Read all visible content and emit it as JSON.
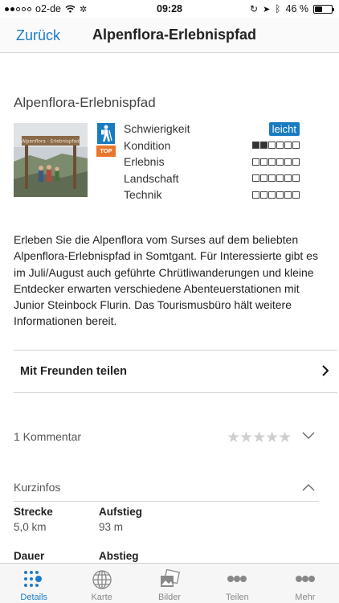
{
  "status_bar": {
    "carrier": "o2-de",
    "time": "09:28",
    "battery": "46 %",
    "battery_level": 0.46
  },
  "nav": {
    "back_label": "Zurück",
    "title": "Alpenflora-Erlebnispfad"
  },
  "tour": {
    "title": "Alpenflora-Erlebnispfad",
    "thumbnail_sign": "Alpenflora - Erlebnispfad",
    "top_badge": "TOP",
    "ratings": [
      {
        "label": "Schwierigkeit",
        "value": "leicht"
      },
      {
        "label": "Kondition",
        "level": 2,
        "max": 6
      },
      {
        "label": "Erlebnis",
        "level": 0,
        "max": 6
      },
      {
        "label": "Landschaft",
        "level": 0,
        "max": 6
      },
      {
        "label": "Technik",
        "level": 0,
        "max": 6
      }
    ],
    "description": "Erleben Sie die Alpenflora vom Surses auf dem beliebten Alpenflora-Erlebnispfad in Somtgant. Für Interessierte gibt es im Juli/August auch geführte Chrütliwanderungen und kleine Entdecker erwarten verschiedene Abenteuerstationen mit Junior Steinbock Flurin. Das Tourismusbüro hält weitere Informationen bereit."
  },
  "share": {
    "label": "Mit Freunden teilen"
  },
  "comments": {
    "label": "1 Kommentar",
    "stars": "★★★★★",
    "rating": 0
  },
  "kurzinfos": {
    "label": "Kurzinfos",
    "strecke": {
      "label": "Strecke",
      "value": "5,0 km"
    },
    "aufstieg": {
      "label": "Aufstieg",
      "value": "93 m"
    },
    "dauer": {
      "label": "Dauer"
    },
    "abstieg": {
      "label": "Abstieg"
    }
  },
  "tabs": [
    {
      "label": "Details",
      "icon": "details-icon",
      "active": true
    },
    {
      "label": "Karte",
      "icon": "globe-icon"
    },
    {
      "label": "Bilder",
      "icon": "photos-icon"
    },
    {
      "label": "Teilen",
      "icon": "share-dots-icon"
    },
    {
      "label": "Mehr",
      "icon": "more-dots-icon"
    }
  ],
  "colors": {
    "accent": "#1e7bc8",
    "badge_blue": "#1a7bbf",
    "top_orange": "#e8772a"
  }
}
